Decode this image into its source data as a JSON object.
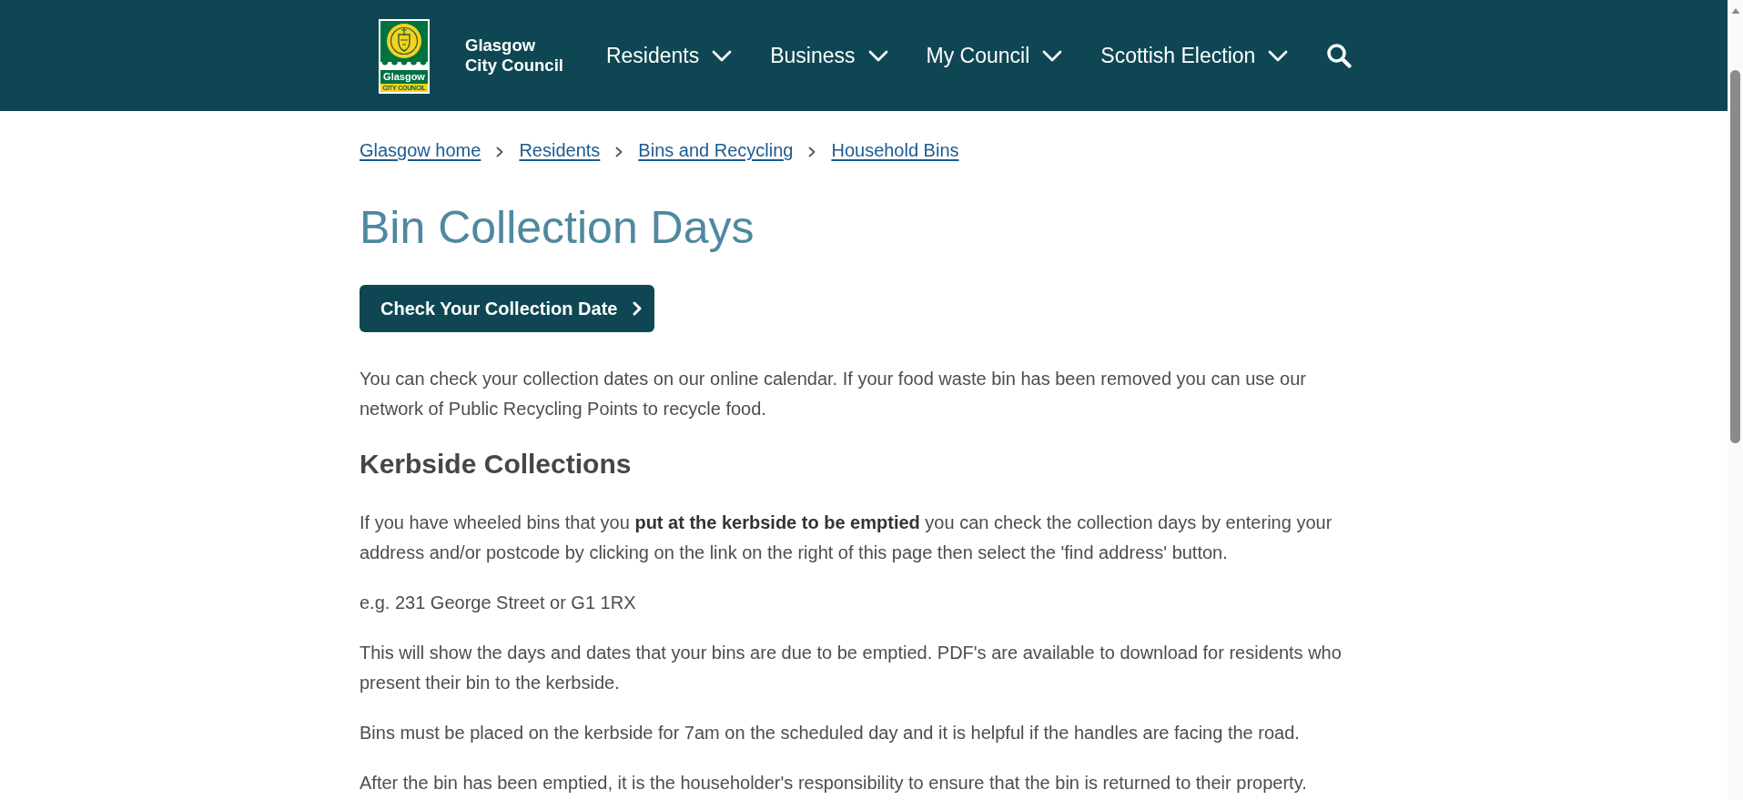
{
  "header": {
    "logo": {
      "wordmark": "Glasgow",
      "subtitle": "CITY COUNCIL"
    },
    "site_name": "Glasgow City Council",
    "nav": [
      {
        "label": "Residents"
      },
      {
        "label": "Business"
      },
      {
        "label": "My Council"
      },
      {
        "label": "Scottish Election"
      }
    ]
  },
  "breadcrumb": [
    {
      "label": "Glasgow home"
    },
    {
      "label": "Residents"
    },
    {
      "label": "Bins and Recycling"
    },
    {
      "label": "Household Bins"
    }
  ],
  "page_title": "Bin Collection Days",
  "cta_button": {
    "label": "Check Your Collection Date"
  },
  "intro": "You can check your collection dates on our online calendar. If your food waste bin has been removed you can use our network of Public Recycling Points to recycle food.",
  "sections": [
    {
      "heading": "Kerbside Collections",
      "paragraphs": [
        "If you have wheeled bins that you **put at the kerbside to be emptied** you can check the collection days by entering your address and/or postcode by clicking on the link on the right of this page then select the 'find address' button.",
        "e.g. 231 George Street or G1 1RX",
        "This will show the days and dates that your bins are due to be emptied. PDF's are available to download for residents who present their bin to the kerbside.",
        "Bins must be placed on the kerbside for 7am on the scheduled day and it is helpful if the handles are facing the road.",
        "After the bin has been emptied, it is the householder's responsibility to ensure that the bin is returned to their property."
      ]
    }
  ]
}
